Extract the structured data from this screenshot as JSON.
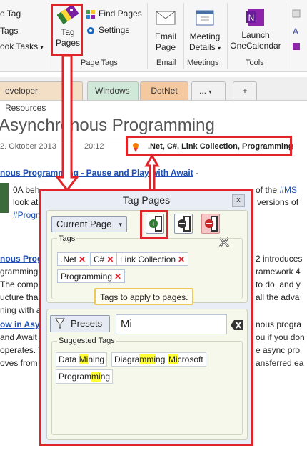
{
  "ribbon": {
    "left_items": {
      "tag": "o Tag",
      "tags": "Tags",
      "book_tasks": "ook Tasks"
    },
    "tag_pages_button": {
      "line1": "Tag",
      "line2": "Pages"
    },
    "find_pages": "Find Pages",
    "settings": "Settings",
    "group_page_tags": "Page Tags",
    "email_page": {
      "line1": "Email",
      "line2": "Page"
    },
    "group_email": "Email",
    "meeting_details": {
      "line1": "Meeting",
      "line2": "Details"
    },
    "group_meetings": "Meetings",
    "launch_onecalendar": {
      "line1": "Launch",
      "line2": "OneCalendar"
    },
    "group_tools": "Tools"
  },
  "tabs": {
    "t1": "eveloper Resources",
    "t2": "Windows",
    "t3": "DotNet",
    "t4": "...",
    "add": "+"
  },
  "page": {
    "title": "Asynchronous Programming",
    "date": "2. Oktober 2013",
    "time": "20:12",
    "page_tags": ".Net, C#, Link Collection, Programming",
    "line1_link": "nous Programming - Pause and Play with Await",
    "line1_rest": " -",
    "line2_a": "0A beh",
    "line2_b": "of the ",
    "line2_link": "#MS",
    "line3_a": "look at",
    "line3_b": "versions of",
    "line4_link": "#Progr",
    "line5_link": "nous Progr",
    "line5_rest": "2 introduces",
    "line6_a": "gramming",
    "line6_b": "ramework 4",
    "line7_a": "The comp",
    "line7_b": "to do, and y",
    "line8_a": "ucture tha",
    "line8_b": "all the adva",
    "line9_a": "ning with a",
    "line10_link": "ow in Asy",
    "line10_rest": "nous progra",
    "line11_a": "and Await",
    "line11_b": "ou if you don",
    "line12_a": "operates. T",
    "line12_b": "e async pro",
    "line13_a": "oves from",
    "line13_b": "ansferred ea"
  },
  "dialog": {
    "title": "Tag Pages",
    "close": "x",
    "scope": "Current Page",
    "tags_label": "Tags",
    "tags": [
      ".Net",
      "C#",
      "Link Collection",
      "Programming"
    ],
    "tooltip": "Tags to apply to pages.",
    "presets": "Presets",
    "search_value": "Mi",
    "suggested_label": "Suggested Tags",
    "suggested": [
      {
        "pre": "Data ",
        "hl": "Mi",
        "post": "ning"
      },
      {
        "pre": "Diagra",
        "hl": "mmi",
        "post": "ng"
      },
      {
        "pre": "",
        "hl": "Mi",
        "post": "crosoft"
      },
      {
        "pre": "Program",
        "hl": "mi",
        "post": "ng"
      }
    ]
  },
  "colors": {
    "annotation_red": "#e0242a",
    "highlight": "#ffff33",
    "link_blue": "#1f4fb5"
  }
}
